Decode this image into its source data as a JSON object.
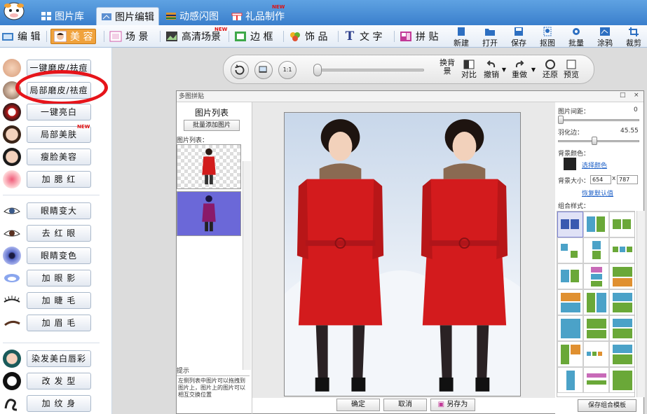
{
  "top_tabs": [
    {
      "label": "图片库",
      "icon": "grid-icon"
    },
    {
      "label": "图片编辑",
      "icon": "edit-icon",
      "active": true
    },
    {
      "label": "动感闪图",
      "icon": "film-icon"
    },
    {
      "label": "礼品制作",
      "icon": "gift-icon",
      "badge": "NEW"
    }
  ],
  "toolbar": {
    "modes": [
      {
        "label": "编 辑",
        "icon": "edit-mode-icon"
      },
      {
        "label": "美 容",
        "icon": "face-icon",
        "active": true
      },
      {
        "label": "场 景",
        "icon": "scene-icon"
      },
      {
        "label": "高清场景",
        "icon": "hd-scene-icon",
        "badge": "NEW"
      },
      {
        "label": "边 框",
        "icon": "frame-icon"
      },
      {
        "label": "饰 品",
        "icon": "ornament-icon"
      },
      {
        "label": "文 字",
        "icon": "text-icon"
      },
      {
        "label": "拼 贴",
        "icon": "collage-icon"
      }
    ],
    "actions": [
      {
        "label": "新建",
        "icon": "new-icon"
      },
      {
        "label": "打开",
        "icon": "open-icon"
      },
      {
        "label": "保存",
        "icon": "save-icon"
      },
      {
        "label": "抠图",
        "icon": "cutout-icon"
      },
      {
        "label": "批量",
        "icon": "batch-icon"
      },
      {
        "label": "涂鸦",
        "icon": "doodle-icon"
      },
      {
        "label": "裁剪",
        "icon": "crop-icon"
      }
    ]
  },
  "left_panel": {
    "buttons": [
      {
        "label": "一键磨皮/祛痘",
        "icon": "face-smooth-icon"
      },
      {
        "label": "局部磨皮/祛痘",
        "icon": "face-local-icon"
      },
      {
        "label": "一键亮白",
        "icon": "opera-mask-icon"
      },
      {
        "label": "局部美肤",
        "icon": "face-skin-icon",
        "badge": "NEW"
      },
      {
        "label": "瘦脸美容",
        "icon": "face-slim-icon"
      },
      {
        "label": "加 腮 红",
        "icon": "blush-icon"
      },
      {
        "label": "眼睛变大",
        "icon": "eye-enlarge-icon"
      },
      {
        "label": "去 红 眼",
        "icon": "red-eye-icon"
      },
      {
        "label": "眼睛变色",
        "icon": "eye-color-icon"
      },
      {
        "label": "加 眼 影",
        "icon": "eye-shadow-icon"
      },
      {
        "label": "加 睫 毛",
        "icon": "eyelash-icon"
      },
      {
        "label": "加 眉 毛",
        "icon": "eyebrow-icon"
      },
      {
        "label": "染发美白唇彩",
        "icon": "hair-dye-icon"
      },
      {
        "label": "改 发 型",
        "icon": "hairstyle-icon"
      },
      {
        "label": "加 纹 身",
        "icon": "tattoo-icon"
      }
    ]
  },
  "control_bar": {
    "buttons": [
      {
        "label": "换背景",
        "icon": "replace-bg-icon"
      },
      {
        "label": "对比",
        "icon": "compare-icon"
      },
      {
        "label": "撤销",
        "icon": "undo-icon"
      },
      {
        "label": "重做",
        "icon": "redo-icon"
      },
      {
        "label": "还原",
        "icon": "restore-icon"
      },
      {
        "label": "预览",
        "icon": "preview-icon"
      }
    ],
    "ratio_label": "1:1"
  },
  "dialog": {
    "title": "多图拼贴",
    "close": "×",
    "photo_list": {
      "title": "图片列表",
      "batch_button": "批量添加图片",
      "list_label": "图片列表：",
      "hint_label": "提示",
      "hint": "左侧列表中图片可以拖拽到图片上，图片上的图片可以相互交换位置"
    },
    "buttons": {
      "ok": "确定",
      "cancel": "取消",
      "save_as": "另存为"
    },
    "right": {
      "spacing_label": "图片间距：",
      "spacing_value": "0",
      "feather_label": "羽化边：",
      "feather_value": "45.55",
      "bg_color_label": "背景颜色：",
      "choose_color": "选择颜色",
      "bg_size_label": "背景大小：",
      "bg_width": "654",
      "bg_height": "787",
      "restore_default": "恢复默认值",
      "layout_label": "组合样式：",
      "save_layout": "保存组合模板"
    }
  }
}
